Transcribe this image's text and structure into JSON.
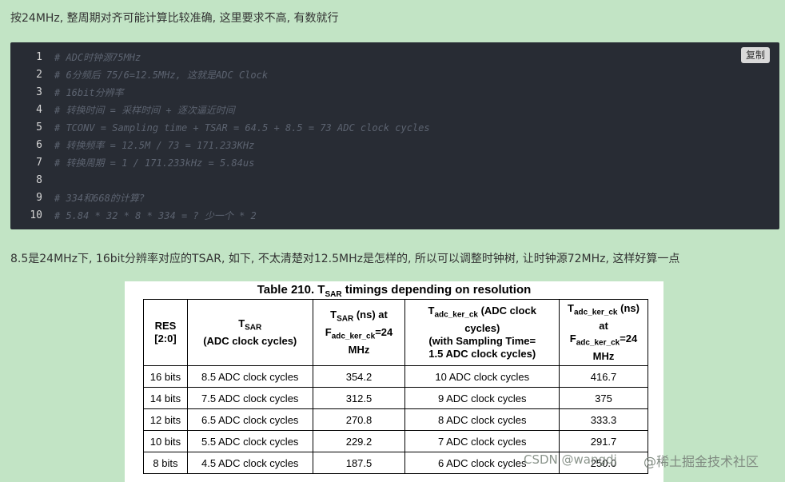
{
  "paragraphs": {
    "p1": "按24MHz, 整周期对齐可能计算比较准确, 这里要求不高, 有数就行",
    "p2": "8.5是24MHz下, 16bit分辨率对应的TSAR, 如下, 不太清楚对12.5MHz是怎样的, 所以可以调整时钟树, 让时钟源72MHz, 这样好算一点"
  },
  "code": {
    "copy_label": "复制",
    "lines": [
      {
        "n": "1",
        "text": "# ADC时钟源75MHz"
      },
      {
        "n": "2",
        "text": "# 6分频后 75/6=12.5MHz, 这就是ADC Clock"
      },
      {
        "n": "3",
        "text": "# 16bit分辨率"
      },
      {
        "n": "4",
        "text": "# 转换时间 = 采样时间 + 逐次逼近时间"
      },
      {
        "n": "5",
        "text": "# TCONV = Sampling time + TSAR = 64.5 + 8.5 = 73 ADC clock cycles"
      },
      {
        "n": "6",
        "text": "# 转换频率 = 12.5M / 73 = 171.233KHz"
      },
      {
        "n": "7",
        "text": "# 转换周期 = 1 / 171.233kHz = 5.84us"
      },
      {
        "n": "8",
        "text": ""
      },
      {
        "n": "9",
        "text": "# 334和668的计算?"
      },
      {
        "n": "10",
        "text": "# 5.84 * 32 * 8 * 334 = ? 少一个 * 2"
      }
    ]
  },
  "table": {
    "title_pre": "Table 210. T",
    "title_sub": "SAR",
    "title_post": " timings depending on resolution",
    "headers": {
      "h1a": "RES",
      "h1b": "[2:0]",
      "h2a": "T",
      "h2sub": "SAR",
      "h2b": "(ADC clock cycles)",
      "h3a": "T",
      "h3sub": "SAR",
      "h3b": " (ns) at",
      "h3c": "F",
      "h3sub2": "adc_ker_ck",
      "h3d": "=24",
      "h3e": "MHz",
      "h4a": "T",
      "h4sub": "adc_ker_ck",
      "h4b": " (ADC clock",
      "h4c": "cycles)",
      "h4d": "(with Sampling Time=",
      "h4e": "1.5 ADC clock cycles)",
      "h5a": "T",
      "h5sub": "adc_ker_ck",
      "h5b": " (ns)",
      "h5c": "at",
      "h5d": "F",
      "h5sub2": "adc_ker_ck",
      "h5e": "=24",
      "h5f": "MHz"
    },
    "rows": [
      [
        "16 bits",
        "8.5 ADC clock cycles",
        "354.2",
        "10 ADC clock cycles",
        "416.7"
      ],
      [
        "14 bits",
        "7.5 ADC clock cycles",
        "312.5",
        "9 ADC clock cycles",
        "375"
      ],
      [
        "12 bits",
        "6.5 ADC clock cycles",
        "270.8",
        "8 ADC clock cycles",
        "333.3"
      ],
      [
        "10 bits",
        "5.5 ADC clock cycles",
        "229.2",
        "7 ADC clock cycles",
        "291.7"
      ],
      [
        "8 bits",
        "4.5 ADC clock cycles",
        "187.5",
        "6 ADC clock cycles",
        "250.0"
      ]
    ]
  },
  "watermarks": {
    "csdn": "CSDN @wangdj",
    "juejin": "@稀土掘金技术社区"
  }
}
